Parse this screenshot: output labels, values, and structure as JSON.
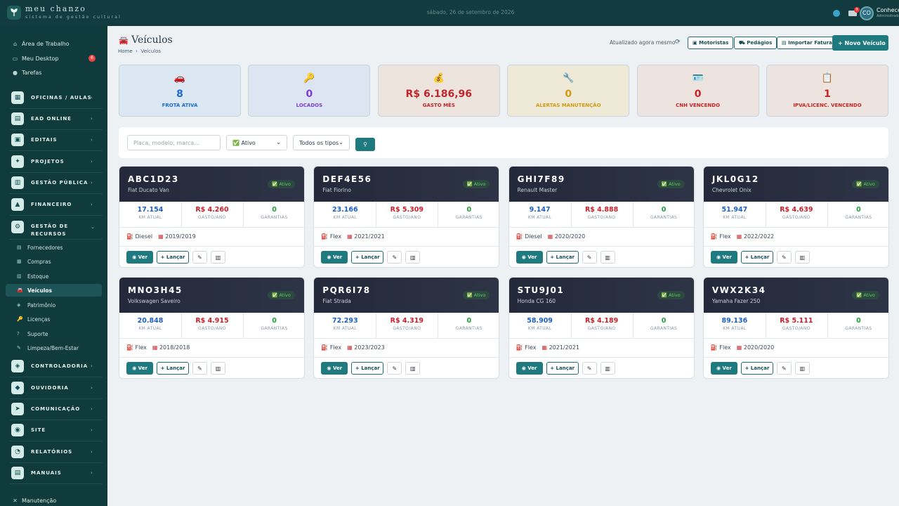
{
  "brand": {
    "name": "meu chanzo",
    "subtitle": "sistema de gestão cultural"
  },
  "topbar": {
    "date": "sábado, 26 de setembro de 2026",
    "notif_count": "9",
    "avatar_initials": "CO",
    "user_name": "Conhecer",
    "user_role": "Administrador"
  },
  "sidebar": {
    "top": [
      {
        "label": "Área de Trabalho",
        "icon": "home-icon"
      },
      {
        "label": "Meu Desktop",
        "icon": "desktop-icon",
        "badge": "6"
      },
      {
        "label": "Tarefas",
        "icon": "check-circle-icon"
      }
    ],
    "groups_a": [
      "OFICINAS / AULAS",
      "EAD ONLINE",
      "EDITAIS",
      "PROJETOS",
      "GESTÃO PÚBLICA",
      "FINANCEIRO"
    ],
    "open_group": "GESTÃO DE RECURSOS",
    "sub": [
      "Fornecedores",
      "Compras",
      "Estoque",
      "Veículos",
      "Patrimônio",
      "Licenças",
      "Suporte",
      "Limpeza/Bem-Estar"
    ],
    "groups_b": [
      "CONTROLADORIA",
      "OUVIDORIA",
      "COMUNICAÇÃO",
      "SITE",
      "RELATÓRIOS",
      "MANUAIS"
    ],
    "footer": "Manutenção"
  },
  "page": {
    "title": "Veículos",
    "crumb_home": "Home",
    "crumb_current": "Veículos",
    "updated": "Atualizado agora mesmo"
  },
  "actions": {
    "motoristas": "Motoristas",
    "pedagios": "Pedágios",
    "importar": "Importar Fatura",
    "novo": "Novo Veículo"
  },
  "stats": [
    {
      "icon": "🚗",
      "value": "8",
      "label": "FROTA ATIVA"
    },
    {
      "icon": "🔑",
      "value": "0",
      "label": "LOCADOS"
    },
    {
      "icon": "💰",
      "value": "R$ 6.186,96",
      "label": "GASTO MÊS"
    },
    {
      "icon": "🔧",
      "value": "0",
      "label": "ALERTAS MANUTENÇÃO"
    },
    {
      "icon": "🪪",
      "value": "0",
      "label": "CNH VENCENDO"
    },
    {
      "icon": "📋",
      "value": "1",
      "label": "IPVA/LICENC. VENCENDO"
    }
  ],
  "filters": {
    "search_placeholder": "Placa, modelo, marca...",
    "status": "✅ Ativo",
    "type": "Todos os tipos"
  },
  "labels": {
    "km": "KM ATUAL",
    "gasto": "GASTO/ANO",
    "garantias": "GARANTIAS",
    "ver": "Ver",
    "lancar": "Lançar",
    "status": "✅ Ativo"
  },
  "vehicles": [
    {
      "plate": "ABC1D23",
      "model": "Fiat Ducato Van",
      "km": "17.154",
      "gasto": "R$ 4.260",
      "garantias": "0",
      "fuel": "Diesel",
      "year": "2019/2019"
    },
    {
      "plate": "DEF4E56",
      "model": "Fiat Fiorino",
      "km": "23.166",
      "gasto": "R$ 5.309",
      "garantias": "0",
      "fuel": "Flex",
      "year": "2021/2021"
    },
    {
      "plate": "GHI7F89",
      "model": "Renault Master",
      "km": "9.147",
      "gasto": "R$ 4.888",
      "garantias": "0",
      "fuel": "Diesel",
      "year": "2020/2020"
    },
    {
      "plate": "JKL0G12",
      "model": "Chevrolet Onix",
      "km": "51.947",
      "gasto": "R$ 4.639",
      "garantias": "0",
      "fuel": "Flex",
      "year": "2022/2022"
    },
    {
      "plate": "MNO3H45",
      "model": "Volkswagen Saveiro",
      "km": "20.848",
      "gasto": "R$ 4.915",
      "garantias": "0",
      "fuel": "Flex",
      "year": "2018/2018"
    },
    {
      "plate": "PQR6I78",
      "model": "Fiat Strada",
      "km": "72.293",
      "gasto": "R$ 4.319",
      "garantias": "0",
      "fuel": "Flex",
      "year": "2023/2023"
    },
    {
      "plate": "STU9J01",
      "model": "Honda CG 160",
      "km": "58.909",
      "gasto": "R$ 4.189",
      "garantias": "0",
      "fuel": "Flex",
      "year": "2021/2021"
    },
    {
      "plate": "VWX2K34",
      "model": "Yamaha Fazer 250",
      "km": "89.136",
      "gasto": "R$ 5.111",
      "garantias": "0",
      "fuel": "Flex",
      "year": "2020/2020"
    }
  ]
}
